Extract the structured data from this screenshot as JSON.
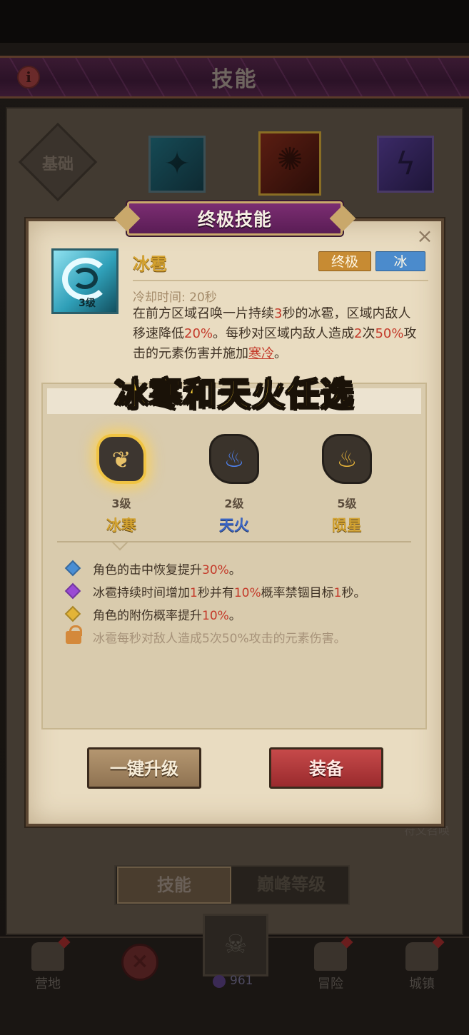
{
  "header": {
    "title": "技能",
    "info_glyph": "i"
  },
  "element_tabs": {
    "basic_label": "基础",
    "tabs": [
      "ice",
      "fire",
      "thunder"
    ],
    "selected": "fire"
  },
  "modal": {
    "title": "终极技能",
    "close_glyph": "×",
    "skill": {
      "name": "冰雹",
      "level_tag": "3级",
      "tags": [
        "终极",
        "冰"
      ],
      "cooldown": "冷却时间: 20秒",
      "description": {
        "p1": "在前方区域召唤一片持续",
        "v1": "3",
        "p2": "秒的冰雹，区域内敌人移速降低",
        "v2": "20%",
        "p3": "。每秒对区域内敌人造成",
        "v3": "2",
        "p4": "次",
        "v4": "50%",
        "p5": "攻击的元素伤害并施加",
        "link": "寒冷",
        "p6": "。"
      }
    },
    "branches": [
      {
        "level": "3级",
        "name": "冰寒",
        "icon": "leaf-icon",
        "selected": true
      },
      {
        "level": "2级",
        "name": "天火",
        "icon": "blue-flame-icon",
        "selected": false
      },
      {
        "level": "5级",
        "name": "陨星",
        "icon": "gold-flame-icon",
        "selected": false
      }
    ],
    "effects": [
      {
        "icon": "blue-diamond-icon",
        "p1": "角色的击中恢复提升",
        "v1": "30%",
        "p2": "。"
      },
      {
        "icon": "purple-diamond-icon",
        "p1": "冰雹持续时间增加",
        "v1": "1",
        "p2": "秒并有",
        "v2": "10%",
        "p3": "概率禁锢目标",
        "v3": "1",
        "p4": "秒。"
      },
      {
        "icon": "gold-diamond-icon",
        "p1": "角色的附伤概率提升",
        "v1": "10%",
        "p2": "。"
      },
      {
        "icon": "lock-icon",
        "text": "冰雹每秒对敌人造成5次50%攻击的元素伤害。",
        "locked": true
      }
    ],
    "buttons": {
      "upgrade": "一键升级",
      "equip": "装备"
    }
  },
  "overlay_caption": "冰寒和天火任选",
  "background": {
    "summon_hint": "符文召唤",
    "bottom_tabs": [
      "技能",
      "巅峰等级"
    ]
  },
  "nav": {
    "items": [
      "营地",
      "冒险",
      "城镇"
    ],
    "gem_count": "961"
  },
  "colors": {
    "accent_gold": "#d4a22f",
    "highlight_red": "#c43a2a",
    "ice_blue": "#4b8bcc",
    "equip_red": "#c64a4a"
  }
}
